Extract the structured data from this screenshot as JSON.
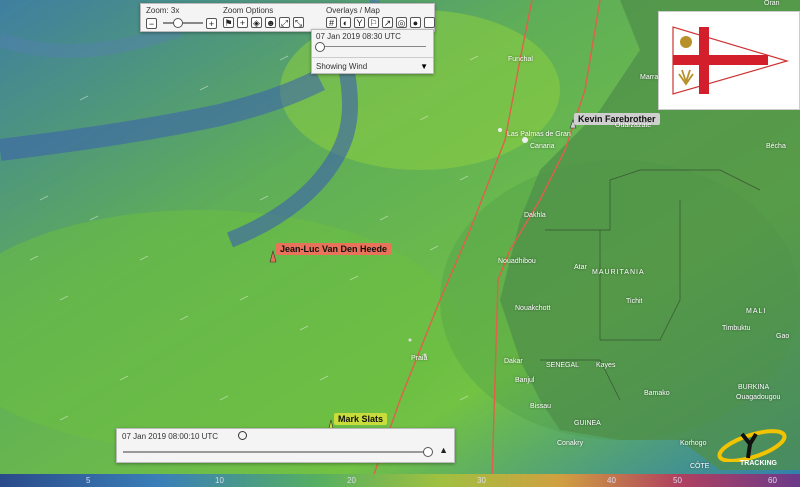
{
  "zoom": {
    "label": "Zoom: 3x",
    "minus": "−",
    "plus": "+"
  },
  "zoom_options": {
    "label": "Zoom Options"
  },
  "overlays": {
    "label": "Overlays / Map"
  },
  "time_overlay": {
    "datetime": "07 Jan 2019 08:30 UTC",
    "mode": "Showing Wind"
  },
  "playback": {
    "datetime": "07 Jan 2019 08:00:10 UTC"
  },
  "boats": [
    {
      "name": "Kevin Farebrother",
      "color": "#cfcfcf",
      "text_color": "#111"
    },
    {
      "name": "Jean-Luc Van Den Heede",
      "color": "#e8735a",
      "text_color": "#111"
    },
    {
      "name": "Mark Slats",
      "color": "#c8dc3c",
      "text_color": "#111"
    }
  ],
  "places": {
    "funchal": "Funchal",
    "las_palmas": "Las Palmas de Gran",
    "canaria": "Canaria",
    "dakhla": "Dakhla",
    "nouadhibou": "Nouadhibou",
    "atar": "Atar",
    "mauritania": "MAURITANIA",
    "tichit": "Tichit",
    "nouakchott": "Nouakchott",
    "timbuktu": "Timbuktu",
    "mali": "MALI",
    "gao": "Gao",
    "dakar": "Dakar",
    "senegal": "SENEGAL",
    "kayes": "Kayes",
    "banjul": "Banjul",
    "bamako": "Bamako",
    "burkina": "BURKINA",
    "ouagadougou": "Ouagadougou",
    "bissau": "Bissau",
    "guinea": "GUINEA",
    "conakry": "Conakry",
    "korhogo": "Korhogo",
    "praia": "Praia",
    "oran": "Oran",
    "marra": "Marra",
    "ouarzazate": "Ouarzazate",
    "bechar": "Bécha",
    "cote": "CÔTE"
  },
  "scale": {
    "ticks": [
      "5",
      "10",
      "20",
      "30",
      "40",
      "50",
      "60"
    ]
  },
  "brand": {
    "name": "TRACKING"
  },
  "colors": {
    "sea_wind": "#5fb848",
    "low_wind": "#3a6fb8",
    "track": "#e0604a",
    "panel": "#f4f4f4"
  }
}
